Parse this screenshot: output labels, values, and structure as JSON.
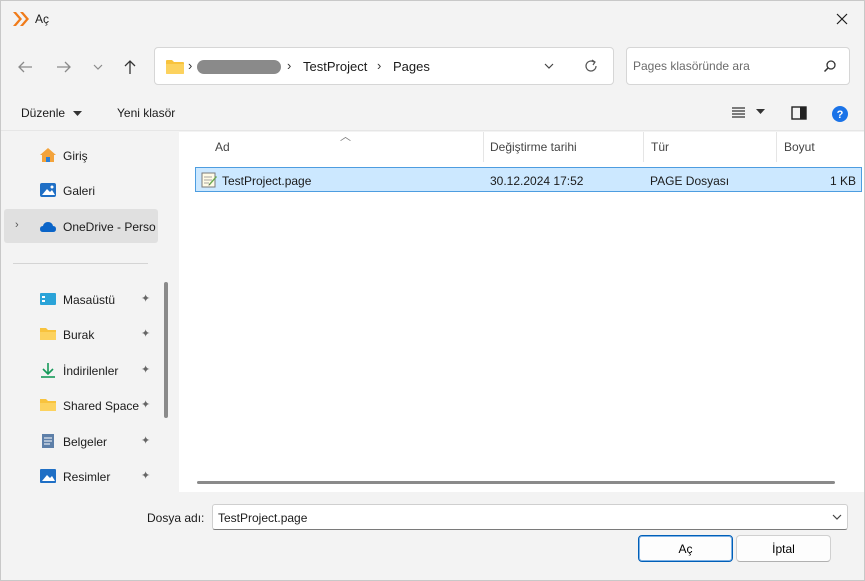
{
  "window": {
    "title": "Aç",
    "accent_color": "#f07b1a"
  },
  "nav": {
    "back_icon": "arrow-left-icon",
    "forward_icon": "arrow-right-icon",
    "recent_icon": "chevron-down-icon",
    "up_icon": "arrow-up-icon"
  },
  "address": {
    "crumbs": [
      "TestProject",
      "Pages"
    ],
    "separator": "›"
  },
  "search": {
    "placeholder": "Pages klasöründe ara"
  },
  "toolbar": {
    "organize_label": "Düzenle",
    "new_folder_label": "Yeni klasör"
  },
  "sidebar": {
    "items": [
      {
        "label": "Giriş",
        "icon": "home-icon"
      },
      {
        "label": "Galeri",
        "icon": "gallery-icon"
      },
      {
        "label": "OneDrive - Perso",
        "icon": "cloud-icon"
      },
      {
        "label": "Masaüstü",
        "icon": "desktop-icon"
      },
      {
        "label": "Burak",
        "icon": "folder-icon"
      },
      {
        "label": "İndirilenler",
        "icon": "download-icon"
      },
      {
        "label": "Shared Space",
        "icon": "folder-icon"
      },
      {
        "label": "Belgeler",
        "icon": "document-icon"
      },
      {
        "label": "Resimler",
        "icon": "pictures-icon"
      }
    ],
    "pin_glyph": "📌"
  },
  "files": {
    "columns": [
      "Ad",
      "Değiştirme tarihi",
      "Tür",
      "Boyut"
    ],
    "rows": [
      {
        "name": "TestProject.page",
        "modified": "30.12.2024 17:52",
        "type": "PAGE Dosyası",
        "size": "1 KB"
      }
    ]
  },
  "footer": {
    "filename_label": "Dosya adı:",
    "filename_value": "TestProject.page",
    "open_label": "Aç",
    "cancel_label": "İptal"
  }
}
